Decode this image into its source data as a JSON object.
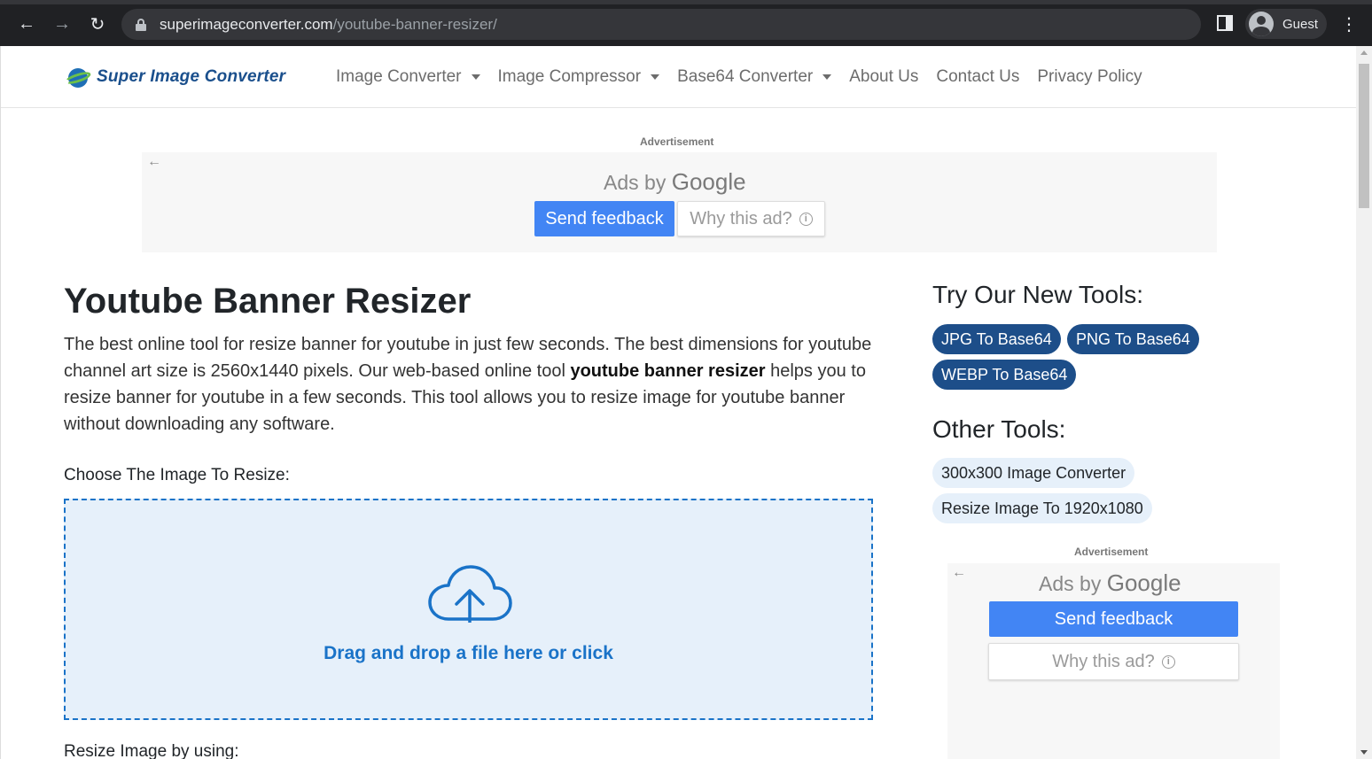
{
  "browser": {
    "url_host": "superimageconverter.com",
    "url_path": "/youtube-banner-resizer/",
    "profile_name": "Guest"
  },
  "header": {
    "logo_text": "Super Image Converter",
    "nav": [
      {
        "label": "Image Converter",
        "dropdown": true
      },
      {
        "label": "Image Compressor",
        "dropdown": true
      },
      {
        "label": "Base64 Converter",
        "dropdown": true
      },
      {
        "label": "About Us",
        "dropdown": false
      },
      {
        "label": "Contact Us",
        "dropdown": false
      },
      {
        "label": "Privacy Policy",
        "dropdown": false
      }
    ]
  },
  "ads": {
    "label": "Advertisement",
    "ads_by": "Ads by",
    "google": "Google",
    "send_feedback": "Send feedback",
    "why_this_ad": "Why this ad?"
  },
  "main": {
    "title": "Youtube Banner Resizer",
    "intro_before": "The best online tool for resize banner for youtube in just few seconds. The best dimensions for youtube channel art size is 2560x1440 pixels. Our web-based online tool ",
    "intro_bold": "youtube banner resizer",
    "intro_after": " helps you to resize banner for youtube in a few seconds. This tool allows you to resize image for youtube banner without downloading any software.",
    "choose_label": "Choose The Image To Resize:",
    "dropzone_text": "Drag and drop a file here or click",
    "resize_by_label": "Resize Image by using:"
  },
  "sidebar": {
    "new_tools_heading": "Try Our New Tools:",
    "new_tools": [
      "JPG To Base64",
      "PNG To Base64",
      "WEBP To Base64"
    ],
    "other_tools_heading": "Other Tools:",
    "other_tools": [
      "300x300 Image Converter",
      "Resize Image To 1920x1080"
    ]
  },
  "colors": {
    "brand_dark": "#1d4e89",
    "link_blue": "#1a73c8",
    "ad_blue": "#4285f4"
  }
}
